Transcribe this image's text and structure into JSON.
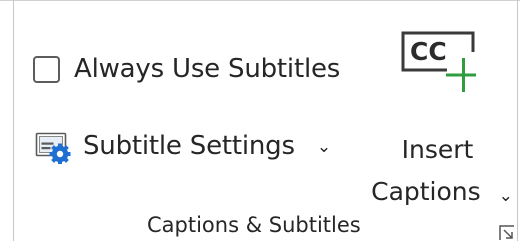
{
  "group": {
    "label": "Captions & Subtitles"
  },
  "always_use_subtitles": {
    "label": "Always Use Subtitles",
    "checked": false
  },
  "subtitle_settings": {
    "label": "Subtitle Settings",
    "icon": "subtitle-settings-icon",
    "chevron": "⌄"
  },
  "insert_captions": {
    "line1": "Insert",
    "line2": "Captions",
    "chevron": "⌄",
    "icon_text": "CC",
    "icon": "cc-add-icon",
    "plus_color": "#2e9d3f"
  },
  "dialog_launcher": {
    "icon": "dialog-launcher-icon"
  }
}
